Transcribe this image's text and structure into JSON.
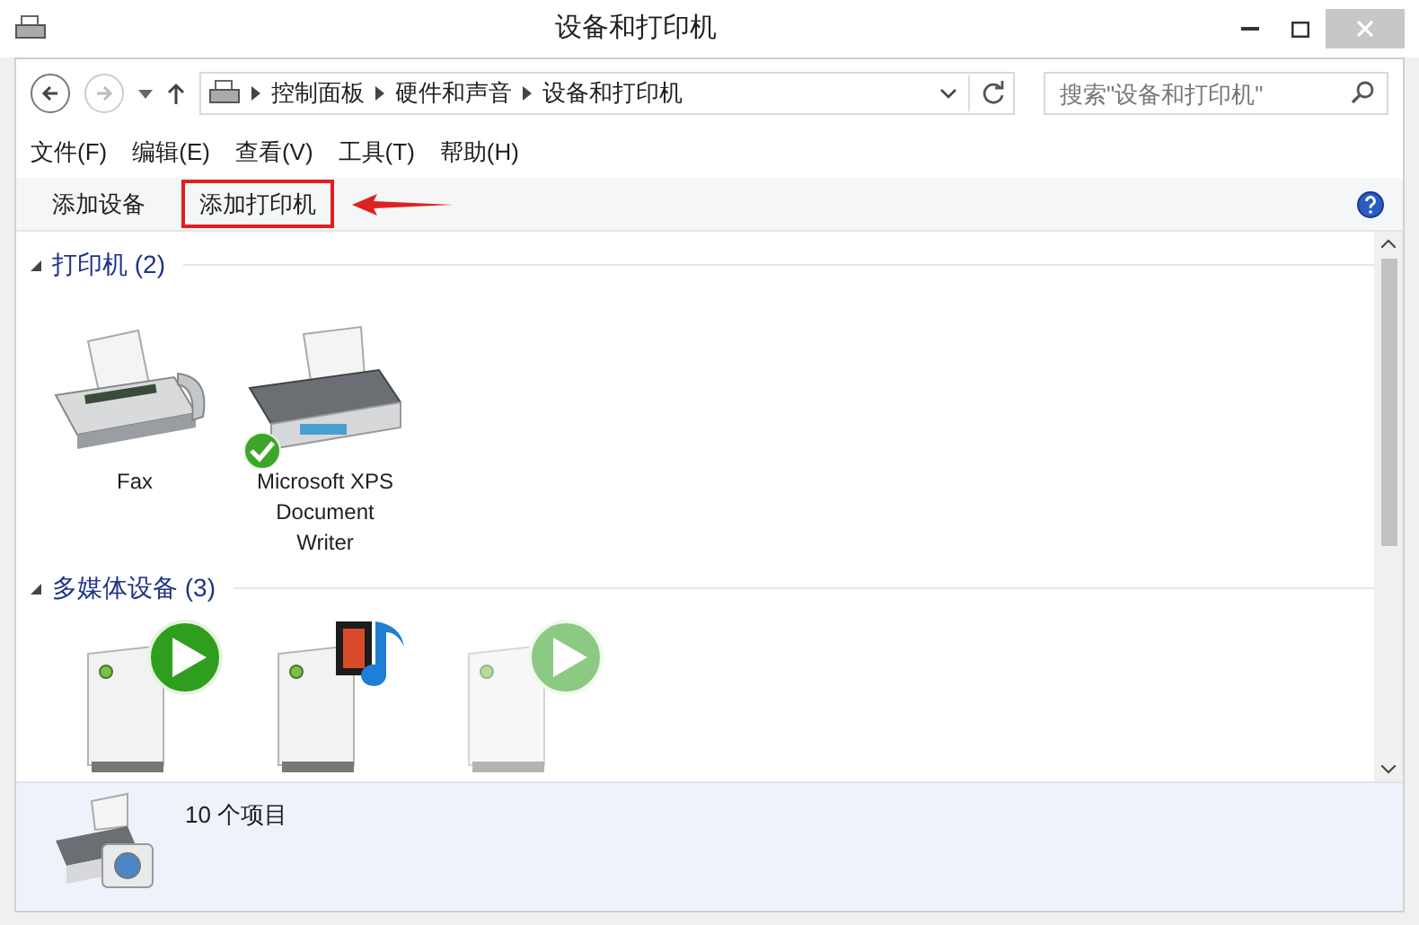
{
  "window": {
    "title": "设备和打印机"
  },
  "address": {
    "breadcrumbs": [
      "控制面板",
      "硬件和声音",
      "设备和打印机"
    ]
  },
  "search": {
    "placeholder": "搜索\"设备和打印机\""
  },
  "menu": [
    "文件(F)",
    "编辑(E)",
    "查看(V)",
    "工具(T)",
    "帮助(H)"
  ],
  "commands": [
    {
      "label": "添加设备",
      "highlighted": false
    },
    {
      "label": "添加打印机",
      "highlighted": true
    }
  ],
  "sections": [
    {
      "title": "打印机 (2)",
      "expanded": true,
      "devices": [
        {
          "kind": "fax",
          "label": "Fax",
          "default": false
        },
        {
          "kind": "printer",
          "label": "Microsoft XPS Document Writer",
          "default": true
        }
      ]
    },
    {
      "title": "多媒体设备 (3)",
      "expanded": true,
      "devices": [
        {
          "kind": "play",
          "dimmed": false
        },
        {
          "kind": "film",
          "dimmed": false
        },
        {
          "kind": "play",
          "dimmed": true
        }
      ]
    }
  ],
  "details": {
    "count": "10 个项目"
  }
}
